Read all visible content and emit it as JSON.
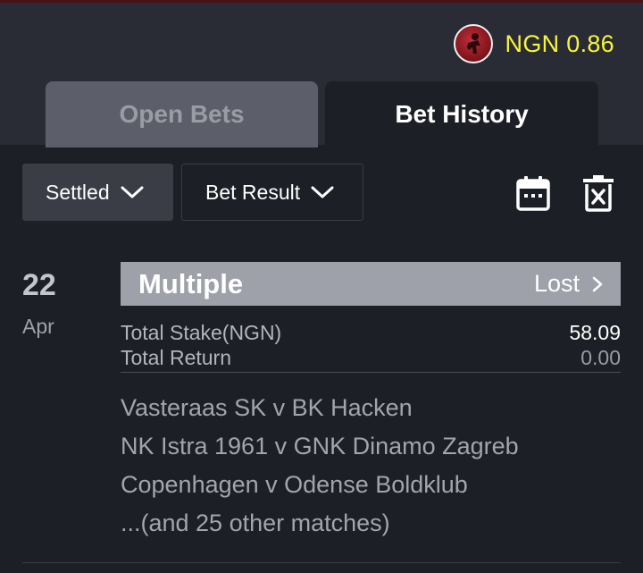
{
  "header": {
    "balance_text": "NGN 0.86",
    "accent_color": "#f7f43a"
  },
  "tabs": [
    {
      "label": "Open Bets",
      "active": false
    },
    {
      "label": "Bet History",
      "active": true
    }
  ],
  "filters": {
    "status_label": "Settled",
    "result_label": "Bet Result"
  },
  "toolbar": {
    "calendar_icon": "calendar-icon",
    "delete_icon": "trash-icon"
  },
  "bet": {
    "date_day": "22",
    "date_month": "Apr",
    "type": "Multiple",
    "status": "Lost",
    "total_stake_label": "Total Stake(NGN)",
    "total_stake_value": "58.09",
    "total_return_label": "Total Return",
    "total_return_value": "0.00",
    "matches": [
      "Vasteraas SK v BK Hacken",
      "NK Istra 1961 v GNK Dinamo Zagreb",
      "Copenhagen v Odense Boldklub",
      "...(and 25 other matches)"
    ]
  }
}
